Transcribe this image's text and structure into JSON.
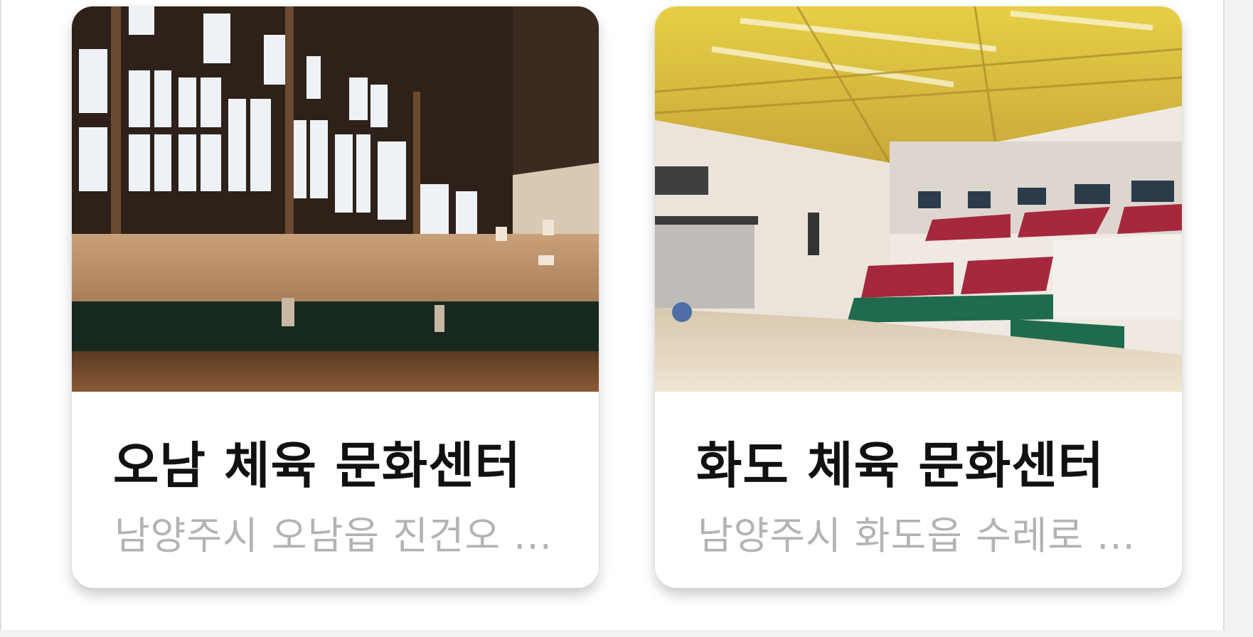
{
  "facilities": [
    {
      "name": "오남 체육 문화센터",
      "address": "남양주시 오남읍 진건오 ...",
      "photo_icon": "gym-interior-photo"
    },
    {
      "name": "화도 체육 문화센터",
      "address": "남양주시 화도읍 수레로 ...",
      "photo_icon": "arena-interior-photo"
    }
  ],
  "colors": {
    "page_background": "#f2f2f4",
    "card_background": "#ffffff",
    "title_text": "#111111",
    "address_text": "#b3b3b3"
  }
}
